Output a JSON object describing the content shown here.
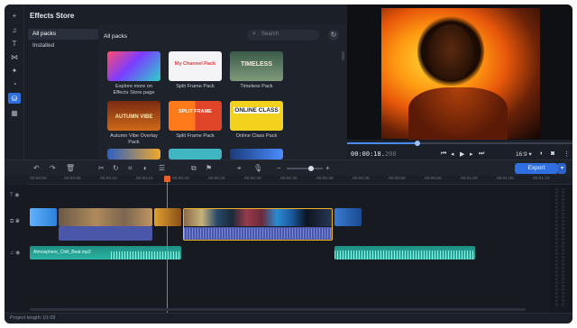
{
  "store": {
    "title": "Effects Store",
    "categories": [
      "All packs",
      "Installed"
    ],
    "packs_header": "All packs",
    "search_placeholder": "Search"
  },
  "packs": [
    {
      "caption": "Explore more on Effects Store page",
      "thumb_text": ""
    },
    {
      "caption": "Split Frame Pack",
      "thumb_text": "My Channel Pack"
    },
    {
      "caption": "Timeless Pack",
      "thumb_text": "TIMELESS"
    },
    {
      "caption": "Autumn Vibe Overlay Pack",
      "thumb_text": "AUTUMN VIBE"
    },
    {
      "caption": "Split Frame Pack",
      "thumb_text": "SPLIT FRAME"
    },
    {
      "caption": "Online Class Pack",
      "thumb_text": "ONLINE CLASS"
    }
  ],
  "player": {
    "time_main": "00:00:18.",
    "time_ms": "200",
    "aspect": "16:9"
  },
  "toolbar": {
    "export_label": "Export"
  },
  "ruler_ticks": [
    "00:00:00",
    "00:00:05",
    "00:00:10",
    "00:00:15",
    "00:00:20",
    "00:00:25",
    "00:00:30",
    "00:00:35",
    "00:00:40",
    "00:00:45",
    "00:00:50",
    "00:00:55",
    "00:01:00",
    "00:01:05",
    "00:01:10"
  ],
  "timeline": {
    "audio_clip_label": "Atmosphere_Chill_Beat.mp3",
    "project_length": "Project length: 01:09"
  },
  "colors": {
    "accent": "#2f6fe0",
    "playhead": "#e8612a",
    "audio": "#2bb3a3",
    "selection": "#f0b429"
  }
}
